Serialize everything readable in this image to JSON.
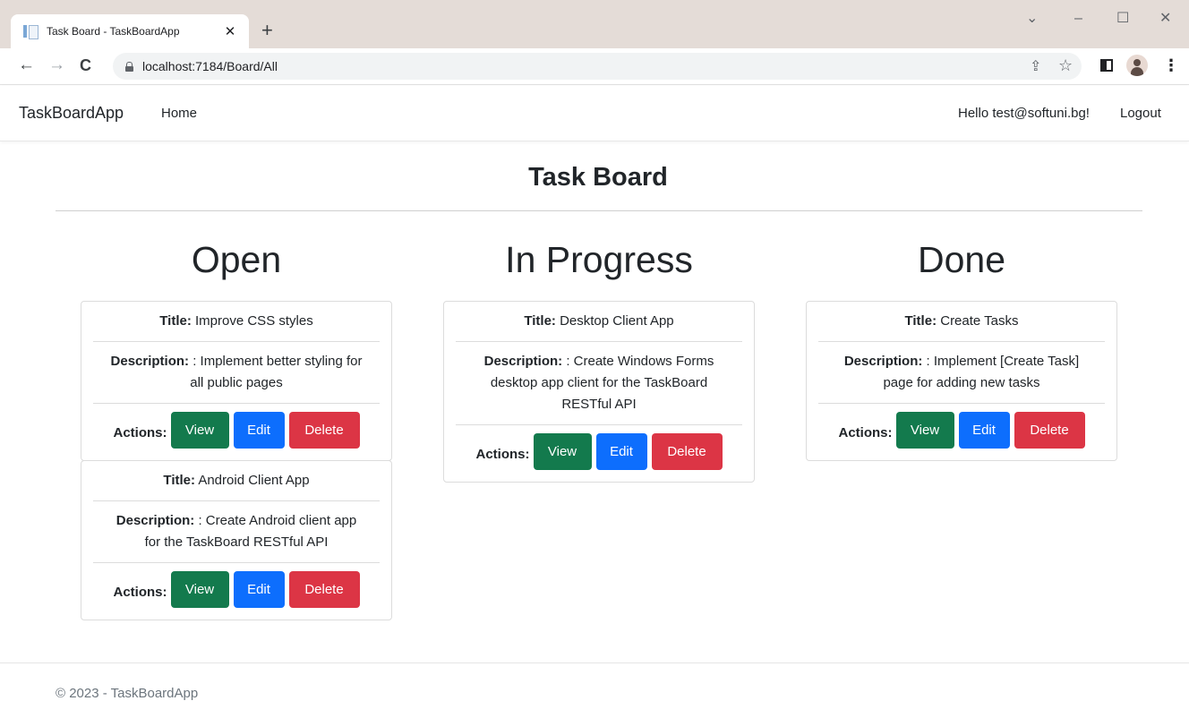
{
  "browser": {
    "tab_title": "Task Board - TaskBoardApp",
    "tab_close": "✕",
    "new_tab": "+",
    "url": "localhost:7184/Board/All",
    "window_controls": {
      "chevron": "⌄",
      "minimize": "–",
      "maximize": "☐",
      "close": "✕"
    },
    "toolbar_glyphs": {
      "back": "←",
      "forward": "→",
      "reload": "C",
      "share": "⇪",
      "star": "☆",
      "menu": "⋮"
    }
  },
  "navbar": {
    "brand": "TaskBoardApp",
    "home": "Home",
    "greeting": "Hello test@softuni.bg!",
    "logout": "Logout"
  },
  "page": {
    "title": "Task Board"
  },
  "labels": {
    "title": "Title:",
    "description": "Description:",
    "actions": "Actions:",
    "view": "View",
    "edit": "Edit",
    "delete": "Delete"
  },
  "columns": [
    {
      "heading": "Open",
      "tasks": [
        {
          "title": "Improve CSS styles",
          "description": ": Implement better styling for all public pages"
        },
        {
          "title": "Android Client App",
          "description": ": Create Android client app for the TaskBoard RESTful API"
        }
      ]
    },
    {
      "heading": "In Progress",
      "tasks": [
        {
          "title": "Desktop Client App",
          "description": ": Create Windows Forms desktop app client for the TaskBoard RESTful API"
        }
      ]
    },
    {
      "heading": "Done",
      "tasks": [
        {
          "title": "Create Tasks",
          "description": ": Implement [Create Task] page for adding new tasks"
        }
      ]
    }
  ],
  "footer": {
    "text": "© 2023 - TaskBoardApp"
  },
  "colors": {
    "view": "#137a4d",
    "edit": "#0d6efd",
    "delete": "#dc3545",
    "tabstrip": "#e4dcd7"
  }
}
